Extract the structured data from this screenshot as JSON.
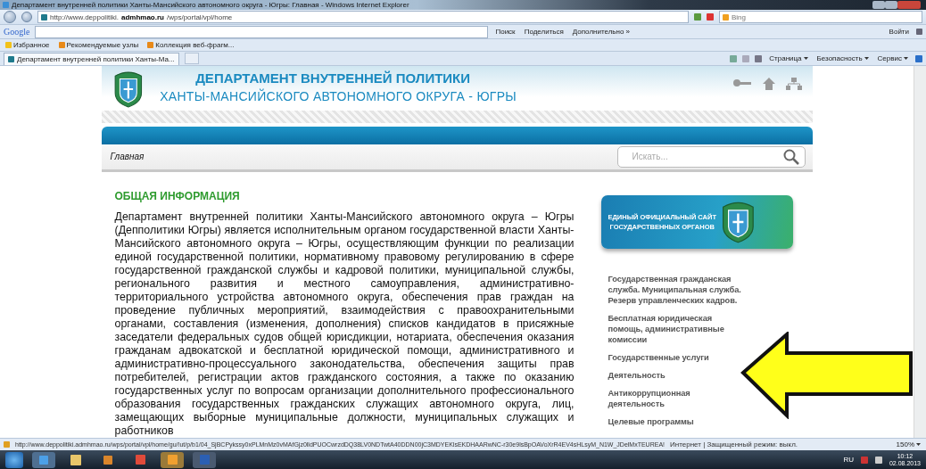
{
  "window": {
    "title": "Департамент внутренней политики Ханты-Мансийского автономного округа - Югры: Главная - Windows Internet Explorer"
  },
  "address_bar": {
    "url_start": "http://www.deppolitiki.",
    "url_domain": "admhmao.ru",
    "url_end": "/wps/portal/vpl/home"
  },
  "search_box": {
    "placeholder": "Bing"
  },
  "google_toolbar": {
    "logo": "Google",
    "buttons": [
      "Поиск",
      "Поделиться",
      "Дополнительно »"
    ],
    "login": "Войти"
  },
  "favorites_bar": {
    "items": [
      "Избранное",
      "Рекомендуемые узлы",
      "Коллекция веб-фрагм..."
    ]
  },
  "tabs": [
    {
      "label": "Департамент внутренней политики Ханты-Ма...",
      "selected": true
    }
  ],
  "command_bar": {
    "menus": [
      "Страница",
      "Безопасность",
      "Сервис"
    ]
  },
  "site": {
    "title_line1": "ДЕПАРТАМЕНТ ВНУТРЕННЕЙ ПОЛИТИКИ",
    "title_line2": "ХАНТЫ-МАНСИЙСКОГО АВТОНОМНОГО ОКРУГА - ЮГРЫ",
    "breadcrumb": "Главная",
    "search": {
      "placeholder": "Искать..."
    },
    "section_title": "ОБЩАЯ ИНФОРМАЦИЯ",
    "body": "Департамент внутренней политики Ханты-Мансийского автономного округа – Югры (Депполитики Югры) является исполнительным органом государственной власти Ханты-Мансийского автономного округа – Югры, осуществляющим функции по реализации единой государственной политики, нормативному правовому регулированию в сфере государственной гражданской службы и кадровой политики, муниципальной службы, регионального развития и местного самоуправления, административно-территориального устройства автономного округа, обеспечения прав граждан на проведение публичных мероприятий, взаимодействия с правоохранительными органами, составления (изменения, дополнения) списков кандидатов в присяжные заседатели федеральных судов общей юрисдикции, нотариата, обеспечения оказания гражданам адвокатской и бесплатной юридической помощи, административного и административно-процессуального законодательства, обеспечения защиты прав потребителей, регистрации актов гражданского состояния, а также по оказанию государственных услуг по вопросам организации дополнительного профессионального образования государственных гражданских служащих автономного округа, лиц, замещающих выборные муниципальные должности, муниципальных служащих и работников",
    "banner": {
      "line1": "ЕДИНЫЙ ОФИЦИАЛЬНЫЙ САЙТ",
      "line2": "ГОСУДАРСТВЕННЫХ ОРГАНОВ"
    },
    "sidebar_links": [
      "Государственная гражданская служба. Муниципальная служба. Резерв управленческих кадров.",
      "Бесплатная юридическая помощь, административные комиссии",
      "Государственные услуги",
      "Деятельность",
      "Антикоррупционная деятельность",
      "Целевые программы"
    ]
  },
  "status_bar": {
    "url": "http://www.deppolitiki.admhmao.ru/wps/portal/vpl/home/gu/!ut/p/b1/04_SjBCPykssy0xPLMnMz0vMAfGjz0lldPUOCwrzdDQ38LV0NDTwtA40DDN00jC3MDYEKlsEKDHAARwNC-r30e9lsBpOAVoXrR4EV4sHLsyM_N1W_JDelMxTEUREA!",
    "zone": "Интернет | Защищенный режим: выкл.",
    "zoom": "150%"
  },
  "taskbar": {
    "language": "RU",
    "time": "10:12",
    "date": "02.08.2013"
  }
}
